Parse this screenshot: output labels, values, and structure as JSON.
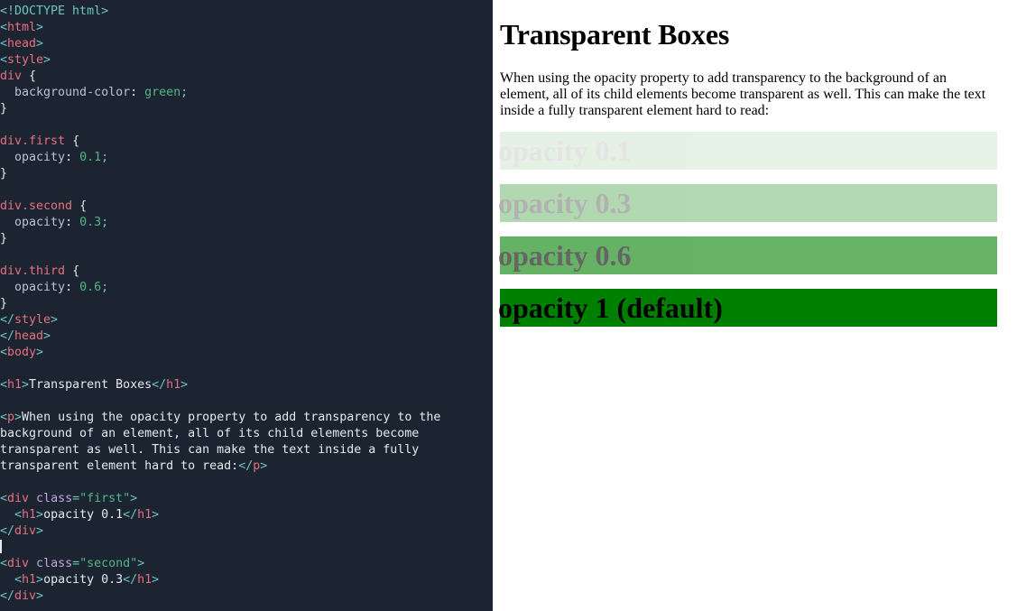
{
  "editor": {
    "language": "html",
    "background_color": "#1b2430",
    "caret_line_index": 19,
    "lines": [
      {
        "i": 0,
        "tokens": [
          {
            "t": "pun",
            "v": "<!DOCTYPE html>"
          }
        ]
      },
      {
        "i": 1,
        "tokens": [
          {
            "t": "pun",
            "v": "<"
          },
          {
            "t": "tag",
            "v": "html"
          },
          {
            "t": "pun",
            "v": ">"
          }
        ]
      },
      {
        "i": 2,
        "tokens": [
          {
            "t": "pun",
            "v": "<"
          },
          {
            "t": "tag",
            "v": "head"
          },
          {
            "t": "pun",
            "v": ">"
          }
        ]
      },
      {
        "i": 3,
        "tokens": [
          {
            "t": "pun",
            "v": "<"
          },
          {
            "t": "tag",
            "v": "style"
          },
          {
            "t": "pun",
            "v": ">"
          }
        ]
      },
      {
        "i": 4,
        "tokens": [
          {
            "t": "sel",
            "v": "div"
          },
          {
            "t": "brace",
            "v": " {"
          }
        ]
      },
      {
        "i": 5,
        "tokens": [
          {
            "t": "prop",
            "v": "  background-color"
          },
          {
            "t": "brace",
            "v": ": "
          },
          {
            "t": "val",
            "v": "green"
          },
          {
            "t": "semi",
            "v": ";"
          }
        ]
      },
      {
        "i": 6,
        "tokens": [
          {
            "t": "brace",
            "v": "}"
          }
        ]
      },
      {
        "i": 7,
        "tokens": []
      },
      {
        "i": 8,
        "tokens": [
          {
            "t": "sel",
            "v": "div.first"
          },
          {
            "t": "brace",
            "v": " {"
          }
        ]
      },
      {
        "i": 9,
        "tokens": [
          {
            "t": "prop",
            "v": "  opacity"
          },
          {
            "t": "brace",
            "v": ": "
          },
          {
            "t": "num",
            "v": "0.1"
          },
          {
            "t": "semi",
            "v": ";"
          }
        ]
      },
      {
        "i": 10,
        "tokens": [
          {
            "t": "brace",
            "v": "}"
          }
        ]
      },
      {
        "i": 11,
        "tokens": []
      },
      {
        "i": 12,
        "tokens": [
          {
            "t": "sel",
            "v": "div.second"
          },
          {
            "t": "brace",
            "v": " {"
          }
        ]
      },
      {
        "i": 13,
        "tokens": [
          {
            "t": "prop",
            "v": "  opacity"
          },
          {
            "t": "brace",
            "v": ": "
          },
          {
            "t": "num",
            "v": "0.3"
          },
          {
            "t": "semi",
            "v": ";"
          }
        ]
      },
      {
        "i": 14,
        "tokens": [
          {
            "t": "brace",
            "v": "}"
          }
        ]
      },
      {
        "i": 15,
        "tokens": []
      },
      {
        "i": 16,
        "tokens": [
          {
            "t": "sel",
            "v": "div.third"
          },
          {
            "t": "brace",
            "v": " {"
          }
        ]
      },
      {
        "i": 17,
        "tokens": [
          {
            "t": "prop",
            "v": "  opacity"
          },
          {
            "t": "brace",
            "v": ": "
          },
          {
            "t": "num",
            "v": "0.6"
          },
          {
            "t": "semi",
            "v": ";"
          }
        ]
      },
      {
        "i": 18,
        "tokens": [
          {
            "t": "brace",
            "v": "}"
          }
        ]
      },
      {
        "i": 19,
        "tokens": [
          {
            "t": "pun",
            "v": "</"
          },
          {
            "t": "tag",
            "v": "style"
          },
          {
            "t": "pun",
            "v": ">"
          }
        ]
      },
      {
        "i": 20,
        "tokens": [
          {
            "t": "pun",
            "v": "</"
          },
          {
            "t": "tag",
            "v": "head"
          },
          {
            "t": "pun",
            "v": ">"
          }
        ]
      },
      {
        "i": 21,
        "tokens": [
          {
            "t": "pun",
            "v": "<"
          },
          {
            "t": "tag",
            "v": "body"
          },
          {
            "t": "pun",
            "v": ">"
          }
        ]
      },
      {
        "i": 22,
        "tokens": []
      },
      {
        "i": 23,
        "tokens": [
          {
            "t": "pun",
            "v": "<"
          },
          {
            "t": "tag",
            "v": "h1"
          },
          {
            "t": "pun",
            "v": ">"
          },
          {
            "t": "txt",
            "v": "Transparent Boxes"
          },
          {
            "t": "pun",
            "v": "</"
          },
          {
            "t": "tag",
            "v": "h1"
          },
          {
            "t": "pun",
            "v": ">"
          }
        ]
      },
      {
        "i": 24,
        "tokens": []
      },
      {
        "i": 25,
        "tokens": [
          {
            "t": "pun",
            "v": "<"
          },
          {
            "t": "tag",
            "v": "p"
          },
          {
            "t": "pun",
            "v": ">"
          },
          {
            "t": "txt",
            "v": "When using the opacity property to add transparency to the"
          }
        ]
      },
      {
        "i": 26,
        "tokens": [
          {
            "t": "txt",
            "v": "background of an element, all of its child elements become"
          }
        ]
      },
      {
        "i": 27,
        "tokens": [
          {
            "t": "txt",
            "v": "transparent as well. This can make the text inside a fully"
          }
        ]
      },
      {
        "i": 28,
        "tokens": [
          {
            "t": "txt",
            "v": "transparent element hard to read:"
          },
          {
            "t": "pun",
            "v": "</"
          },
          {
            "t": "tag",
            "v": "p"
          },
          {
            "t": "pun",
            "v": ">"
          }
        ]
      },
      {
        "i": 29,
        "tokens": []
      },
      {
        "i": 30,
        "tokens": [
          {
            "t": "pun",
            "v": "<"
          },
          {
            "t": "tag",
            "v": "div"
          },
          {
            "t": "att",
            "v": " class"
          },
          {
            "t": "pun",
            "v": "="
          },
          {
            "t": "str",
            "v": "\"first\""
          },
          {
            "t": "pun",
            "v": ">"
          }
        ]
      },
      {
        "i": 31,
        "tokens": [
          {
            "t": "pun",
            "v": "  <"
          },
          {
            "t": "tag",
            "v": "h1"
          },
          {
            "t": "pun",
            "v": ">"
          },
          {
            "t": "txt",
            "v": "opacity 0.1"
          },
          {
            "t": "pun",
            "v": "</"
          },
          {
            "t": "tag",
            "v": "h1"
          },
          {
            "t": "pun",
            "v": ">"
          }
        ]
      },
      {
        "i": 32,
        "tokens": [
          {
            "t": "pun",
            "v": "</"
          },
          {
            "t": "tag",
            "v": "div"
          },
          {
            "t": "pun",
            "v": ">"
          }
        ]
      },
      {
        "i": 33,
        "tokens": [],
        "caret": true
      },
      {
        "i": 34,
        "tokens": [
          {
            "t": "pun",
            "v": "<"
          },
          {
            "t": "tag",
            "v": "div"
          },
          {
            "t": "att",
            "v": " class"
          },
          {
            "t": "pun",
            "v": "="
          },
          {
            "t": "str",
            "v": "\"second\""
          },
          {
            "t": "pun",
            "v": ">"
          }
        ]
      },
      {
        "i": 35,
        "tokens": [
          {
            "t": "pun",
            "v": "  <"
          },
          {
            "t": "tag",
            "v": "h1"
          },
          {
            "t": "pun",
            "v": ">"
          },
          {
            "t": "txt",
            "v": "opacity 0.3"
          },
          {
            "t": "pun",
            "v": "</"
          },
          {
            "t": "tag",
            "v": "h1"
          },
          {
            "t": "pun",
            "v": ">"
          }
        ]
      },
      {
        "i": 36,
        "tokens": [
          {
            "t": "pun",
            "v": "</"
          },
          {
            "t": "tag",
            "v": "div"
          },
          {
            "t": "pun",
            "v": ">"
          }
        ]
      }
    ]
  },
  "scrollbar": {
    "track_color": "#3e4c59",
    "thumb_color": "#000000"
  },
  "preview": {
    "heading": "Transparent Boxes",
    "paragraph": "When using the opacity property to add transparency to the background of an element, all of its child elements become transparent as well. This can make the text inside a fully transparent element hard to read:",
    "box_color": "#008000",
    "boxes": [
      {
        "label": "opacity 0.1",
        "opacity": 0.1
      },
      {
        "label": "opacity 0.3",
        "opacity": 0.3
      },
      {
        "label": "opacity 0.6",
        "opacity": 0.6
      },
      {
        "label": "opacity 1 (default)",
        "opacity": 1
      }
    ]
  }
}
